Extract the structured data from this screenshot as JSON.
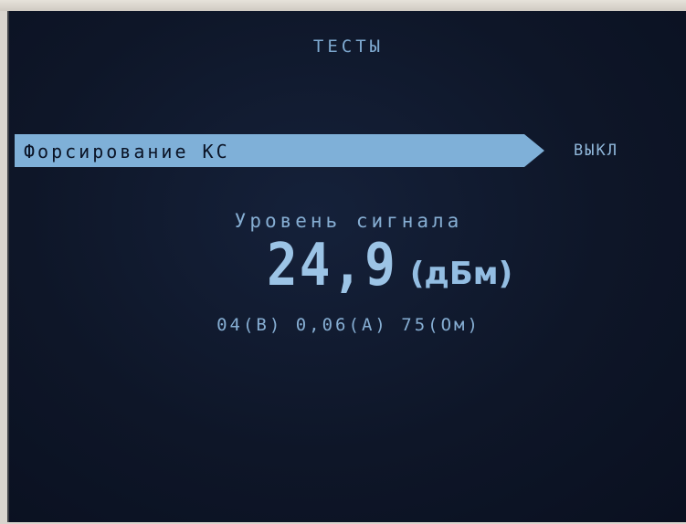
{
  "screen": {
    "title": "ТЕСТЫ"
  },
  "menu": {
    "item_label": "Форсирование КС",
    "item_value": "ВЫКЛ"
  },
  "signal": {
    "label": "Уровень сигнала",
    "value": "24,9",
    "unit": "(дБм)"
  },
  "readings": {
    "text": "04(В) 0,06(А) 75(Ом)"
  },
  "colors": {
    "background": "#0e1628",
    "text": "#8fb6d9",
    "highlight_bar": "#7fb0d8",
    "highlight_text": "#0b1426"
  }
}
